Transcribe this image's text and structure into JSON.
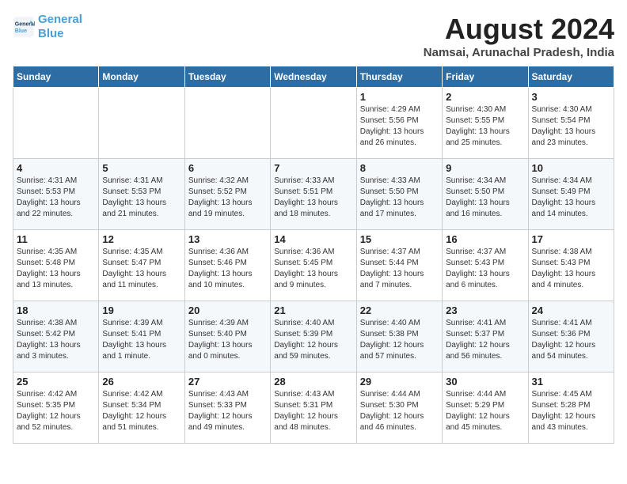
{
  "logo": {
    "line1": "General",
    "line2": "Blue"
  },
  "title": "August 2024",
  "subtitle": "Namsai, Arunachal Pradesh, India",
  "days_header": [
    "Sunday",
    "Monday",
    "Tuesday",
    "Wednesday",
    "Thursday",
    "Friday",
    "Saturday"
  ],
  "weeks": [
    [
      {
        "day": "",
        "info": ""
      },
      {
        "day": "",
        "info": ""
      },
      {
        "day": "",
        "info": ""
      },
      {
        "day": "",
        "info": ""
      },
      {
        "day": "1",
        "info": "Sunrise: 4:29 AM\nSunset: 5:56 PM\nDaylight: 13 hours\nand 26 minutes."
      },
      {
        "day": "2",
        "info": "Sunrise: 4:30 AM\nSunset: 5:55 PM\nDaylight: 13 hours\nand 25 minutes."
      },
      {
        "day": "3",
        "info": "Sunrise: 4:30 AM\nSunset: 5:54 PM\nDaylight: 13 hours\nand 23 minutes."
      }
    ],
    [
      {
        "day": "4",
        "info": "Sunrise: 4:31 AM\nSunset: 5:53 PM\nDaylight: 13 hours\nand 22 minutes."
      },
      {
        "day": "5",
        "info": "Sunrise: 4:31 AM\nSunset: 5:53 PM\nDaylight: 13 hours\nand 21 minutes."
      },
      {
        "day": "6",
        "info": "Sunrise: 4:32 AM\nSunset: 5:52 PM\nDaylight: 13 hours\nand 19 minutes."
      },
      {
        "day": "7",
        "info": "Sunrise: 4:33 AM\nSunset: 5:51 PM\nDaylight: 13 hours\nand 18 minutes."
      },
      {
        "day": "8",
        "info": "Sunrise: 4:33 AM\nSunset: 5:50 PM\nDaylight: 13 hours\nand 17 minutes."
      },
      {
        "day": "9",
        "info": "Sunrise: 4:34 AM\nSunset: 5:50 PM\nDaylight: 13 hours\nand 16 minutes."
      },
      {
        "day": "10",
        "info": "Sunrise: 4:34 AM\nSunset: 5:49 PM\nDaylight: 13 hours\nand 14 minutes."
      }
    ],
    [
      {
        "day": "11",
        "info": "Sunrise: 4:35 AM\nSunset: 5:48 PM\nDaylight: 13 hours\nand 13 minutes."
      },
      {
        "day": "12",
        "info": "Sunrise: 4:35 AM\nSunset: 5:47 PM\nDaylight: 13 hours\nand 11 minutes."
      },
      {
        "day": "13",
        "info": "Sunrise: 4:36 AM\nSunset: 5:46 PM\nDaylight: 13 hours\nand 10 minutes."
      },
      {
        "day": "14",
        "info": "Sunrise: 4:36 AM\nSunset: 5:45 PM\nDaylight: 13 hours\nand 9 minutes."
      },
      {
        "day": "15",
        "info": "Sunrise: 4:37 AM\nSunset: 5:44 PM\nDaylight: 13 hours\nand 7 minutes."
      },
      {
        "day": "16",
        "info": "Sunrise: 4:37 AM\nSunset: 5:43 PM\nDaylight: 13 hours\nand 6 minutes."
      },
      {
        "day": "17",
        "info": "Sunrise: 4:38 AM\nSunset: 5:43 PM\nDaylight: 13 hours\nand 4 minutes."
      }
    ],
    [
      {
        "day": "18",
        "info": "Sunrise: 4:38 AM\nSunset: 5:42 PM\nDaylight: 13 hours\nand 3 minutes."
      },
      {
        "day": "19",
        "info": "Sunrise: 4:39 AM\nSunset: 5:41 PM\nDaylight: 13 hours\nand 1 minute."
      },
      {
        "day": "20",
        "info": "Sunrise: 4:39 AM\nSunset: 5:40 PM\nDaylight: 13 hours\nand 0 minutes."
      },
      {
        "day": "21",
        "info": "Sunrise: 4:40 AM\nSunset: 5:39 PM\nDaylight: 12 hours\nand 59 minutes."
      },
      {
        "day": "22",
        "info": "Sunrise: 4:40 AM\nSunset: 5:38 PM\nDaylight: 12 hours\nand 57 minutes."
      },
      {
        "day": "23",
        "info": "Sunrise: 4:41 AM\nSunset: 5:37 PM\nDaylight: 12 hours\nand 56 minutes."
      },
      {
        "day": "24",
        "info": "Sunrise: 4:41 AM\nSunset: 5:36 PM\nDaylight: 12 hours\nand 54 minutes."
      }
    ],
    [
      {
        "day": "25",
        "info": "Sunrise: 4:42 AM\nSunset: 5:35 PM\nDaylight: 12 hours\nand 52 minutes."
      },
      {
        "day": "26",
        "info": "Sunrise: 4:42 AM\nSunset: 5:34 PM\nDaylight: 12 hours\nand 51 minutes."
      },
      {
        "day": "27",
        "info": "Sunrise: 4:43 AM\nSunset: 5:33 PM\nDaylight: 12 hours\nand 49 minutes."
      },
      {
        "day": "28",
        "info": "Sunrise: 4:43 AM\nSunset: 5:31 PM\nDaylight: 12 hours\nand 48 minutes."
      },
      {
        "day": "29",
        "info": "Sunrise: 4:44 AM\nSunset: 5:30 PM\nDaylight: 12 hours\nand 46 minutes."
      },
      {
        "day": "30",
        "info": "Sunrise: 4:44 AM\nSunset: 5:29 PM\nDaylight: 12 hours\nand 45 minutes."
      },
      {
        "day": "31",
        "info": "Sunrise: 4:45 AM\nSunset: 5:28 PM\nDaylight: 12 hours\nand 43 minutes."
      }
    ]
  ]
}
